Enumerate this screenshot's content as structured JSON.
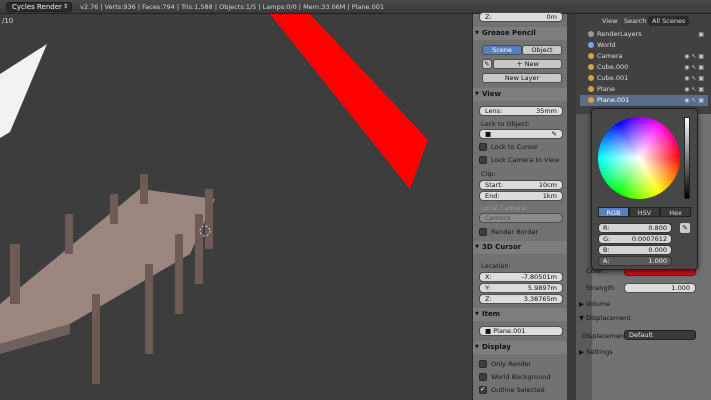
{
  "infobar": {
    "render_engine": "Cycles Render",
    "stats": "v2.76 | Verts:936 | Faces:794 | Tris:1,588 | Objects:1/5 | Lamps:0/0 | Mem:33.06M | Plane.001"
  },
  "viewport": {
    "frame_label": "/10"
  },
  "npanel": {
    "z_label": "Z:",
    "z_value": "0m",
    "grease_pencil": {
      "title": "Grease Pencil",
      "scene_tab": "Scene",
      "object_tab": "Object",
      "new_label": "New",
      "new_layer_label": "New Layer"
    },
    "view": {
      "title": "View",
      "lens_label": "Lens:",
      "lens_value": "35mm",
      "lock_to_object": "Lock to Object:",
      "lock_to_cursor": "Lock to Cursor",
      "lock_camera_to_view": "Lock Camera to View",
      "clip_label": "Clip:",
      "start_label": "Start:",
      "start_value": "10cm",
      "end_label": "End:",
      "end_value": "1km",
      "local_camera": "Local Camera:",
      "camera_value": "Camera",
      "render_border": "Render Border"
    },
    "cursor": {
      "title": "3D Cursor",
      "location_label": "Location:",
      "x_label": "X:",
      "x_value": "-7.80501m",
      "y_label": "Y:",
      "y_value": "5.9897m",
      "z_label": "Z:",
      "z_value": "3.38765m"
    },
    "item": {
      "title": "Item",
      "name": "Plane.001"
    },
    "display": {
      "title": "Display",
      "only_render": "Only Render",
      "world_background": "World Background",
      "outline_selected": "Outline Selected"
    }
  },
  "outliner": {
    "tabs": [
      "View",
      "Search",
      "All Scenes"
    ],
    "items": [
      {
        "label": "RenderLayers",
        "color": "#9a9a9a"
      },
      {
        "label": "World",
        "color": "#7aa7d8"
      },
      {
        "label": "Camera",
        "color": "#d8a040"
      },
      {
        "label": "Cube.000",
        "color": "#d8a040"
      },
      {
        "label": "Cube.001",
        "color": "#d8a040"
      },
      {
        "label": "Plane",
        "color": "#d8a040"
      },
      {
        "label": "Plane.001",
        "color": "#d8a040"
      }
    ]
  },
  "properties": {
    "color_label": "Color:",
    "strength_label": "Strength",
    "strength_value": "1.000",
    "volume": "Volume",
    "displacement_section": "Displacement",
    "displacement_label": "Displacement:",
    "displacement_value": "Default",
    "settings": "Settings",
    "surface_color": "#e01010"
  },
  "color_picker": {
    "modes": [
      "RGB",
      "HSV",
      "Hex"
    ],
    "r_label": "R:",
    "r_value": "0.800",
    "g_label": "G:",
    "g_value": "0.0007612",
    "b_label": "B:",
    "b_value": "0.000",
    "a_label": "A:",
    "a_value": "1.000"
  }
}
